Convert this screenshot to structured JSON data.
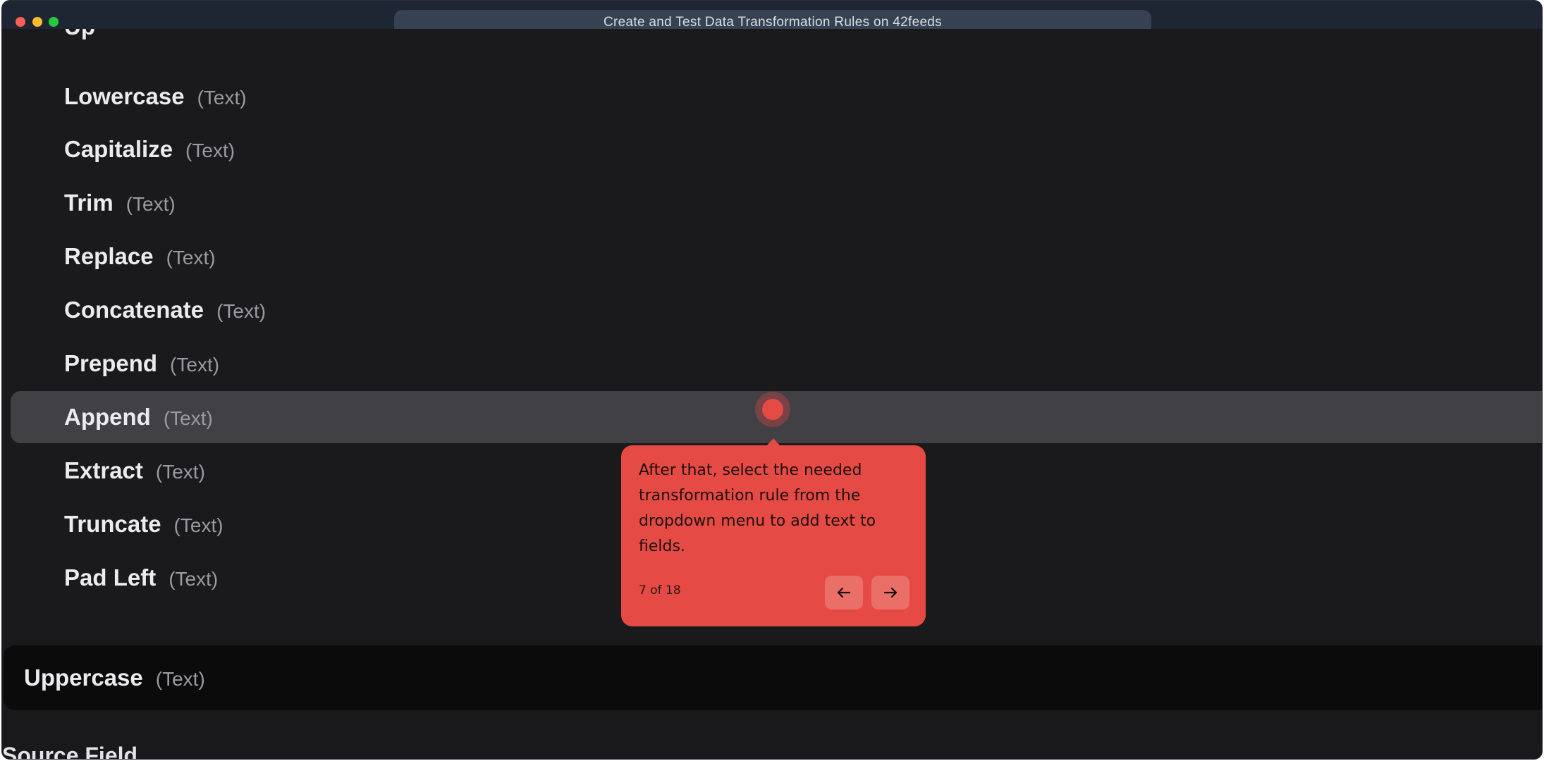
{
  "browser": {
    "title": "Create and Test Data Transformation Rules on 42feeds"
  },
  "dropdown": {
    "items": [
      {
        "name": "Lowercase",
        "type": "(Text)"
      },
      {
        "name": "Capitalize",
        "type": "(Text)"
      },
      {
        "name": "Trim",
        "type": "(Text)"
      },
      {
        "name": "Replace",
        "type": "(Text)"
      },
      {
        "name": "Concatenate",
        "type": "(Text)"
      },
      {
        "name": "Prepend",
        "type": "(Text)"
      },
      {
        "name": "Append",
        "type": "(Text)"
      },
      {
        "name": "Extract",
        "type": "(Text)"
      },
      {
        "name": "Truncate",
        "type": "(Text)"
      },
      {
        "name": "Pad Left",
        "type": "(Text)"
      }
    ],
    "highlighted_item": "Append"
  },
  "selected_rule": {
    "name": "Uppercase",
    "type": "(Text)"
  },
  "source_field": {
    "label": "Source Field"
  },
  "tour": {
    "text": "After that, select the needed transformation rule from the dropdown menu to add text to fields.",
    "step": "7 of 18",
    "accent_color": "#e54b44",
    "prev_icon": "arrow-left-icon",
    "next_icon": "arrow-right-icon"
  }
}
